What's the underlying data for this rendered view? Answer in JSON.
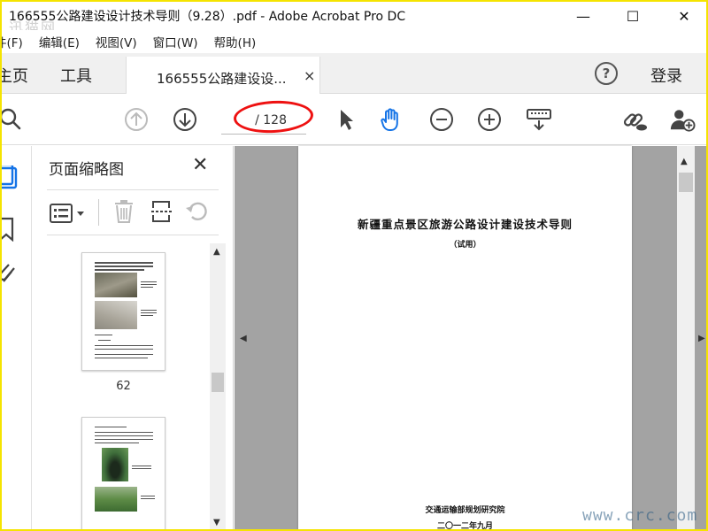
{
  "window": {
    "title": "166555公路建设设计技术导则（9.28）.pdf - Adobe Acrobat Pro DC",
    "minimize": "—",
    "maximize": "☐",
    "close": "✕",
    "watermark_top": "迅猫网"
  },
  "menu": {
    "items": [
      "件(F)",
      "编辑(E)",
      "视图(V)",
      "窗口(W)",
      "帮助(H)"
    ]
  },
  "tabs": {
    "home": "主页",
    "tools": "工具",
    "document": "166555公路建设设...",
    "close": "×",
    "help": "?",
    "login": "登录"
  },
  "toolbar": {
    "page_indicator": "/ 128"
  },
  "panel": {
    "title": "页面缩略图",
    "close": "✕",
    "thumbnails": [
      {
        "label": "62"
      },
      {
        "label": ""
      }
    ]
  },
  "document": {
    "title": "新疆重点景区旅游公路设计建设技术导则",
    "subtitle": "（试用）",
    "organization": "交通运输部规划研究院",
    "date": "二〇一二年九月"
  },
  "watermark_bottom": "www.crc.com",
  "colors": {
    "frame_border": "#f5e400",
    "annotation_red": "#e11111",
    "hand_tool_blue": "#1473e6",
    "doc_background": "#a3a3a3"
  },
  "icons": [
    "search-icon",
    "page-up-icon",
    "page-down-icon",
    "select-arrow-icon",
    "hand-tool-icon",
    "zoom-out-icon",
    "zoom-in-icon",
    "keyboard-icon",
    "share-link-icon",
    "add-user-icon"
  ]
}
